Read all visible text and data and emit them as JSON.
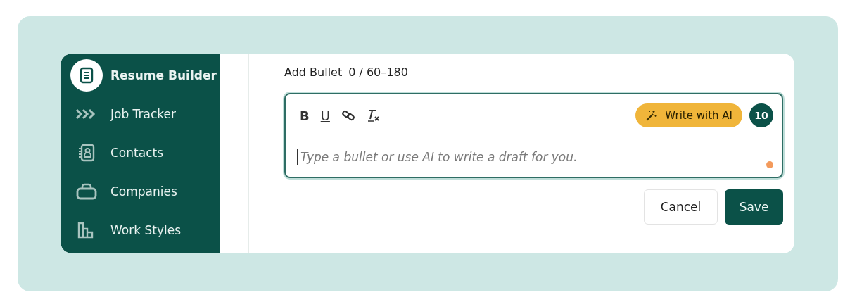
{
  "sidebar": {
    "items": [
      {
        "label": "Resume Builder",
        "selected": true
      },
      {
        "label": "Job Tracker",
        "selected": false
      },
      {
        "label": "Contacts",
        "selected": false
      },
      {
        "label": "Companies",
        "selected": false
      },
      {
        "label": "Work Styles",
        "selected": false
      }
    ]
  },
  "editor": {
    "label": "Add Bullet",
    "counter": "0 / 60–180",
    "toolbar": [
      {
        "kind": "bold",
        "label": "B"
      },
      {
        "kind": "underline",
        "label": "U"
      },
      {
        "kind": "link"
      },
      {
        "kind": "clear"
      }
    ],
    "ai_button": "Write with AI",
    "credits": "10",
    "placeholder": "Type a bullet or use AI to write a draft for you.",
    "status_dot": {
      "color": "#f39a5c"
    }
  },
  "buttons": [
    {
      "kind": "secondary",
      "label": "Cancel"
    },
    {
      "kind": "primary",
      "label": "Save"
    }
  ]
}
